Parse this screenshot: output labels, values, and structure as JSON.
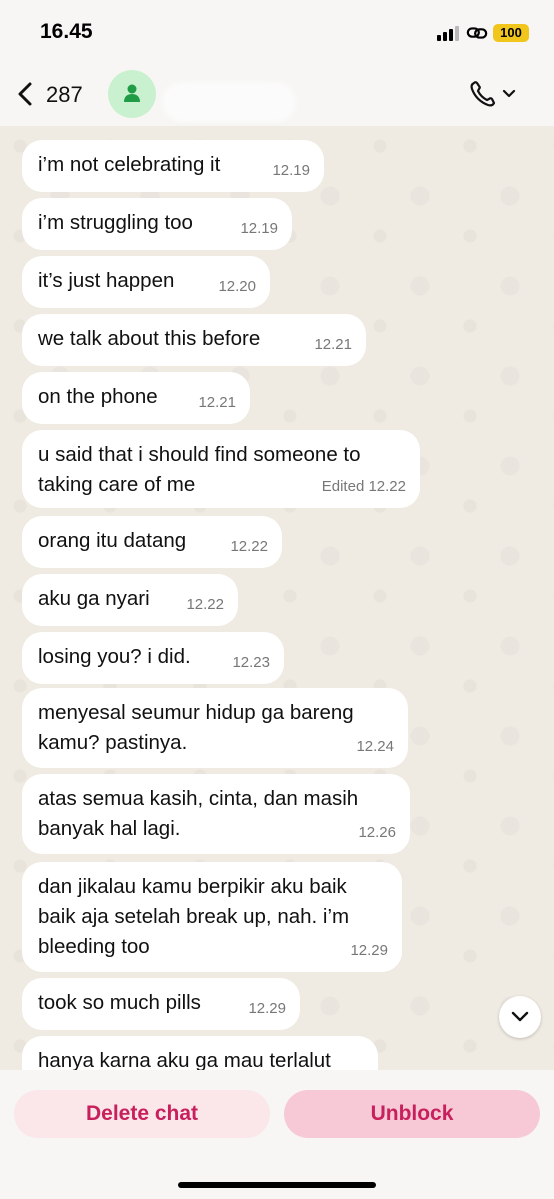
{
  "status_bar": {
    "time": "16.45",
    "battery": "100"
  },
  "header": {
    "back_count": "287"
  },
  "messages": [
    {
      "text": "i’m not celebrating it",
      "time": "12.19"
    },
    {
      "text": "i’m struggling too",
      "time": "12.19"
    },
    {
      "text": "it’s just happen",
      "time": "12.20"
    },
    {
      "text": "we talk about this before",
      "time": "12.21"
    },
    {
      "text": "on the phone",
      "time": "12.21"
    },
    {
      "text": "u said that i should find someone to taking care of me",
      "time": "Edited 12.22"
    },
    {
      "text": "orang itu datang",
      "time": "12.22"
    },
    {
      "text": "aku ga nyari",
      "time": "12.22"
    },
    {
      "text": "losing you? i did.",
      "time": "12.23"
    },
    {
      "text": "menyesal seumur hidup ga bareng kamu? pastinya.",
      "time": "12.24"
    },
    {
      "text": "atas semua kasih, cinta, dan masih banyak hal lagi.",
      "time": "12.26"
    },
    {
      "text": "dan jikalau kamu berpikir aku baik baik aja setelah break up, nah. i’m bleeding too",
      "time": "12.29"
    },
    {
      "text": "took so much pills",
      "time": "12.29"
    },
    {
      "text": "hanya karna aku ga mau terlalut",
      "time": ""
    }
  ],
  "actions": {
    "delete_label": "Delete chat",
    "unblock_label": "Unblock"
  },
  "colors": {
    "accent": "#c8205c",
    "bubble": "#ffffff",
    "chat_bg": "#efeae2",
    "battery": "#f0c51c"
  }
}
